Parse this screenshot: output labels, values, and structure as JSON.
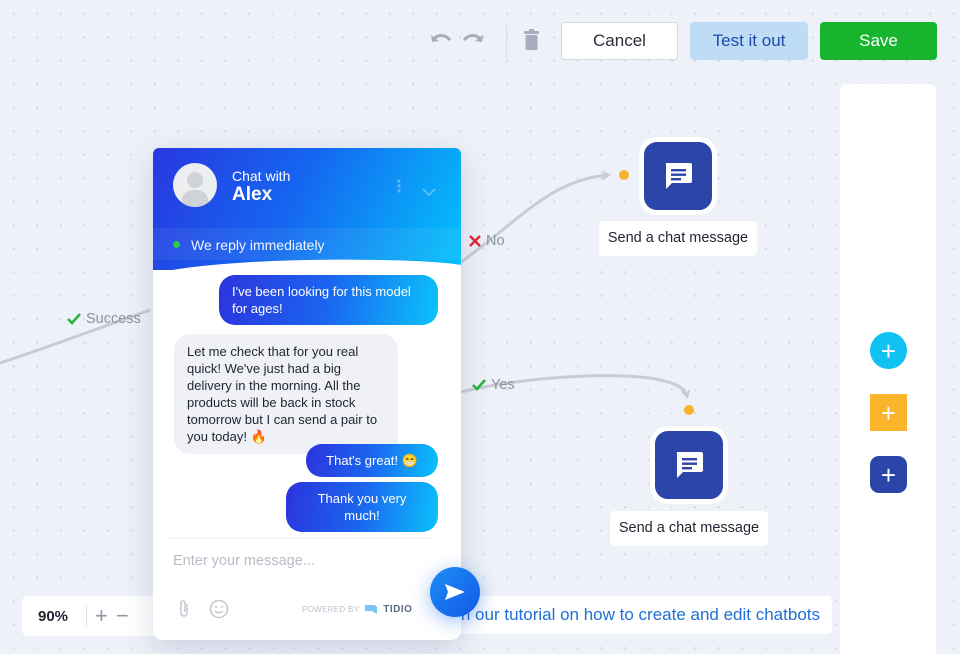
{
  "toolbar": {
    "undo_icon": "undo-icon",
    "redo_icon": "redo-icon",
    "delete_icon": "trash-icon",
    "cancel_label": "Cancel",
    "test_label": "Test it out",
    "save_label": "Save"
  },
  "colors": {
    "save": "#17b52e",
    "test": "#bfdcf7",
    "node": "#2b45a9",
    "connector_dot": "#f7b32b",
    "add_cyan": "#10c2f2",
    "add_yellow": "#fbb52a",
    "add_navy": "#2b45a9"
  },
  "canvas": {
    "edges": [
      {
        "label": "Success",
        "icon": "check-icon"
      },
      {
        "label": "No",
        "icon": "cross-icon"
      },
      {
        "label": "Yes",
        "icon": "check-icon"
      }
    ],
    "nodes": [
      {
        "label": "Send a chat message",
        "icon": "chat-message-icon"
      },
      {
        "label": "Send a chat message",
        "icon": "chat-message-icon"
      }
    ]
  },
  "right_panel": {
    "buttons": [
      {
        "name": "add-trigger",
        "icon": "plus-icon"
      },
      {
        "name": "add-condition",
        "icon": "plus-icon"
      },
      {
        "name": "add-action",
        "icon": "plus-icon"
      }
    ]
  },
  "zoom": {
    "level": "90%",
    "zoom_in": "+",
    "zoom_out": "−"
  },
  "tutorial": {
    "text": "Watch our tutorial on how to create and edit chatbots"
  },
  "chat_widget": {
    "title_small": "Chat with",
    "title_name": "Alex",
    "status": "We reply immediately",
    "messages": [
      {
        "from": "visitor",
        "text": "I've been looking for this model for ages!"
      },
      {
        "from": "operator",
        "text": "Let me check that for you real quick! We've just had a big delivery in the morning. All the products will be back in stock tomorrow but I can send a pair to you today! 🔥"
      },
      {
        "from": "visitor",
        "text": "That's great! 😁"
      },
      {
        "from": "visitor",
        "text": "Thank you very much!"
      }
    ],
    "input_placeholder": "Enter your message...",
    "powered_by": "POWERED BY",
    "brand": "TIDIO"
  }
}
